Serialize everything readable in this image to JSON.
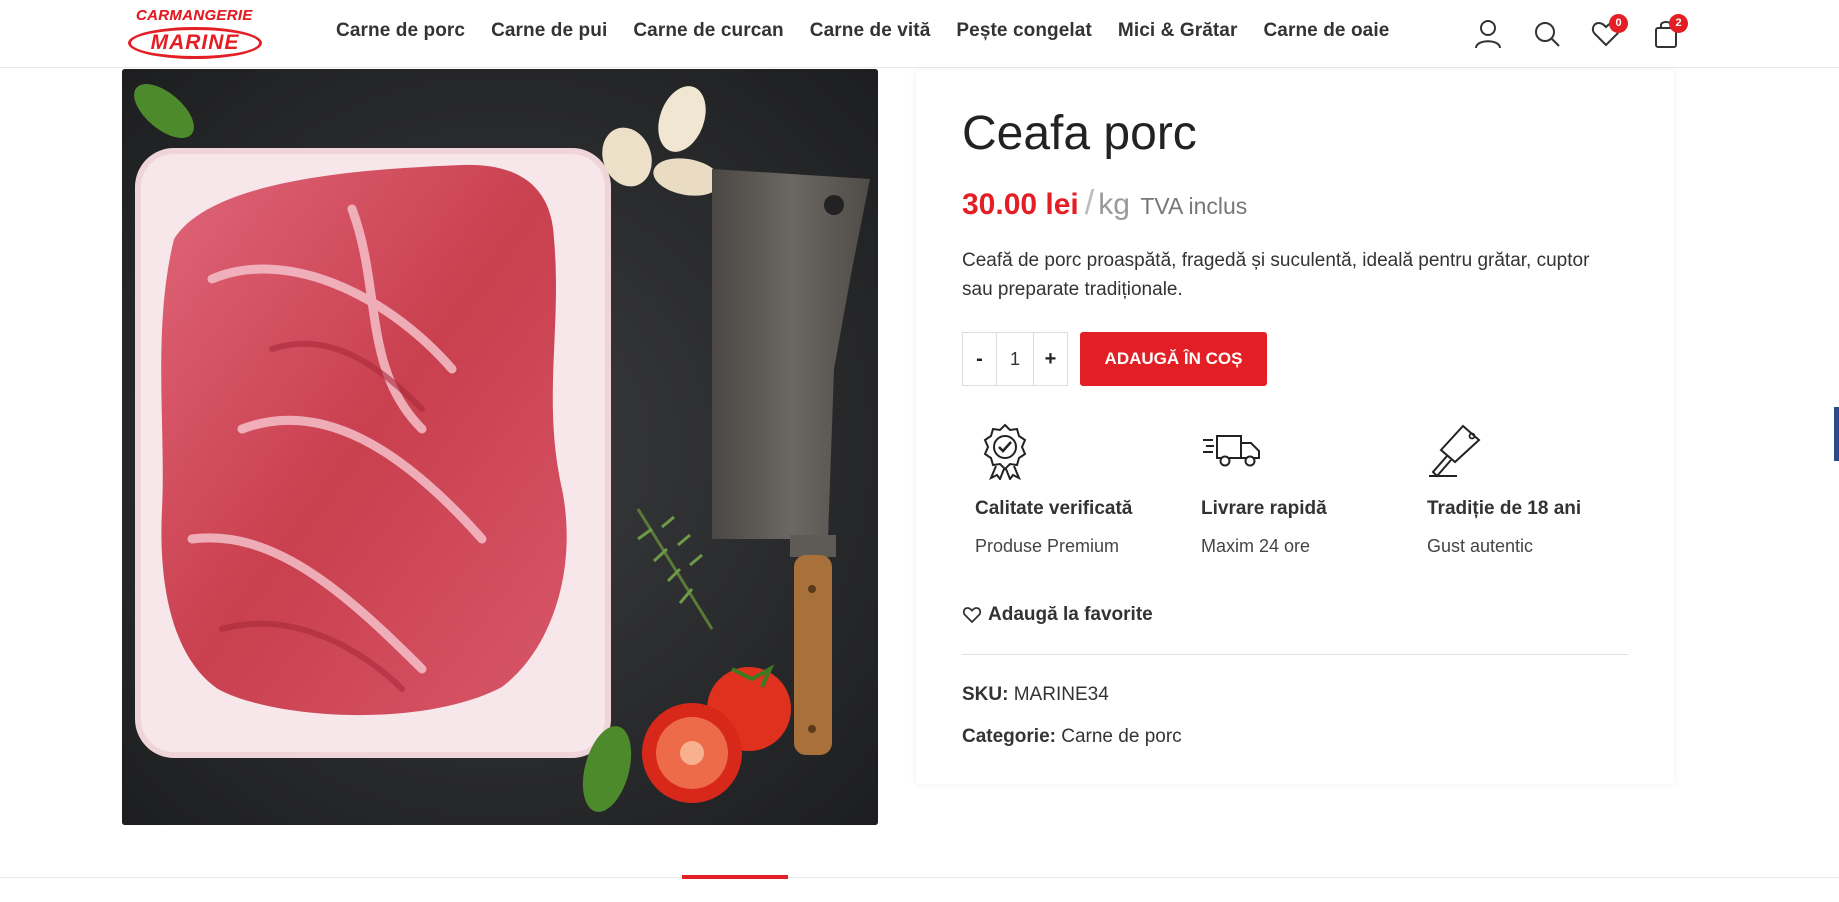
{
  "header": {
    "logo": {
      "top": "CARMANGERIE",
      "main": "MARINE"
    },
    "nav": [
      "Carne de porc",
      "Carne de pui",
      "Carne de curcan",
      "Carne de vită",
      "Pește congelat",
      "Mici & Grătar",
      "Carne de oaie"
    ],
    "icons": [
      "user-icon",
      "search-icon",
      "heart-icon",
      "cart-icon"
    ],
    "wishlist_count": "0",
    "cart_count": "2"
  },
  "product": {
    "title": "Ceafa porc",
    "price": "30.00 lei",
    "price_sep": "/",
    "unit": "kg",
    "tax": "TVA inclus",
    "description": "Ceafă de porc proaspătă, fragedă și suculentă, ideală pentru grătar, cuptor sau preparate tradiționale.",
    "quantity": "1",
    "qty_minus": "-",
    "qty_plus": "+",
    "add_to_cart": "ADAUGĂ ÎN COȘ",
    "features": [
      {
        "icon": "quality-badge-icon",
        "title": "Calitate verificată",
        "subtitle": "Produse Premium"
      },
      {
        "icon": "delivery-truck-icon",
        "title": "Livrare rapidă",
        "subtitle": "Maxim 24 ore"
      },
      {
        "icon": "cleaver-icon",
        "title": "Tradiție de 18 ani",
        "subtitle": "Gust autentic"
      }
    ],
    "favorite": "Adaugă la favorite",
    "sku_label": "SKU:",
    "sku": "MARINE34",
    "category_label": "Categorie:",
    "category": "Carne de porc"
  },
  "colors": {
    "accent": "#e31e24",
    "text": "#333333",
    "background": "#ffffff"
  }
}
